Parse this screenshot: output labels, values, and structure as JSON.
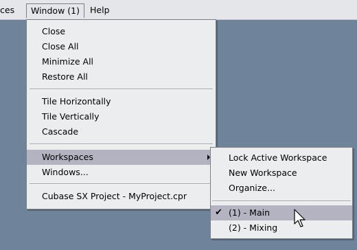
{
  "menubar": {
    "prev_label": "ces",
    "window_label": "Window (1)",
    "help_label": "Help"
  },
  "window_menu": {
    "items": {
      "close": "Close",
      "close_all": "Close All",
      "minimize_all": "Minimize All",
      "restore_all": "Restore All",
      "tile_horizontally": "Tile Horizontally",
      "tile_vertically": "Tile Vertically",
      "cascade": "Cascade",
      "workspaces": "Workspaces",
      "windows": "Windows...",
      "project": "Cubase SX Project - MyProject.cpr"
    }
  },
  "workspaces_submenu": {
    "items": {
      "lock": "Lock Active Workspace",
      "new": "New Workspace",
      "organize": "Organize...",
      "ws1": "(1) - Main",
      "ws2": "(2) - Mixing"
    },
    "checked_item": "(1) - Main",
    "check_glyph": "✔"
  },
  "colors": {
    "desktop_bg": "#6f849a",
    "menu_bg": "#ecedef",
    "highlight": "#b4b3c1"
  }
}
